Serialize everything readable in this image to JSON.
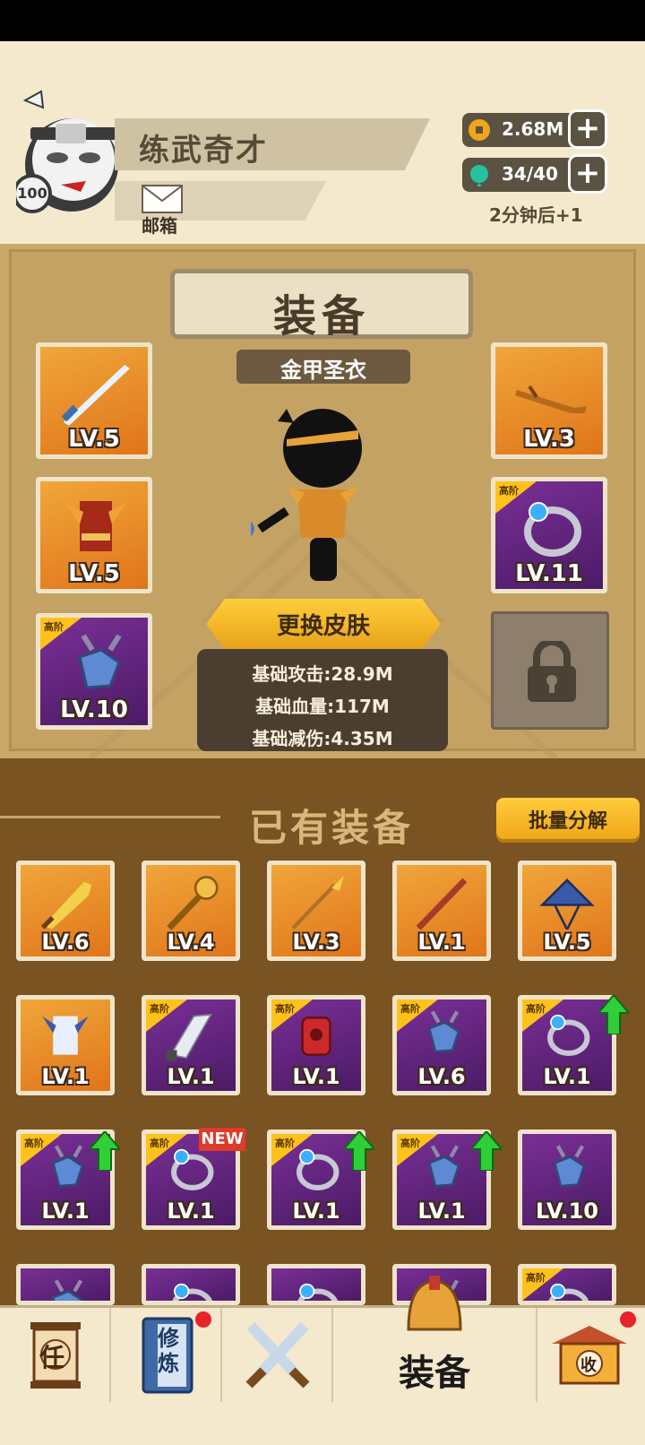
{
  "player": {
    "name": "练武奇才",
    "level": "100",
    "mail_label": "邮箱"
  },
  "resources": {
    "coins": "2.68M",
    "energy": "34/40",
    "timer": "2分钟后+1"
  },
  "equip_panel": {
    "title": "装备",
    "set_name": "金甲圣衣",
    "skin_button": "更换皮肤",
    "stats": [
      "基础攻击:28.9M",
      "基础血量:117M",
      "基础减伤:4.35M"
    ],
    "slots": [
      {
        "item": "sword",
        "level": "LV.5",
        "rarity": "orange",
        "tier": ""
      },
      {
        "item": "armor",
        "level": "LV.5",
        "rarity": "orange",
        "tier": ""
      },
      {
        "item": "amulet",
        "level": "LV.10",
        "rarity": "purple",
        "tier": "高阶"
      },
      {
        "item": "blade-hilt",
        "level": "LV.3",
        "rarity": "orange",
        "tier": ""
      },
      {
        "item": "ring",
        "level": "LV.11",
        "rarity": "purple",
        "tier": "高阶"
      }
    ]
  },
  "owned": {
    "title": "已有装备",
    "batch_button": "批量分解",
    "new_label": "NEW",
    "items": [
      {
        "item": "broadsword",
        "level": "LV.6",
        "rarity": "orange",
        "tier": ""
      },
      {
        "item": "mace",
        "level": "LV.4",
        "rarity": "orange",
        "tier": ""
      },
      {
        "item": "spear",
        "level": "LV.3",
        "rarity": "orange",
        "tier": ""
      },
      {
        "item": "staff",
        "level": "LV.1",
        "rarity": "orange",
        "tier": ""
      },
      {
        "item": "hat",
        "level": "LV.5",
        "rarity": "orange",
        "tier": ""
      },
      {
        "item": "robe",
        "level": "LV.1",
        "rarity": "orange",
        "tier": ""
      },
      {
        "item": "machete",
        "level": "LV.1",
        "rarity": "purple",
        "tier": "高阶"
      },
      {
        "item": "gauntlet",
        "level": "LV.1",
        "rarity": "purple",
        "tier": "高阶"
      },
      {
        "item": "amulet",
        "level": "LV.6",
        "rarity": "purple",
        "tier": "高阶"
      },
      {
        "item": "ring",
        "level": "LV.1",
        "rarity": "purple",
        "tier": "高阶"
      },
      {
        "item": "amulet",
        "level": "LV.1",
        "rarity": "purple",
        "tier": "高阶"
      },
      {
        "item": "ring",
        "level": "LV.1",
        "rarity": "purple",
        "tier": "高阶"
      },
      {
        "item": "ring",
        "level": "LV.1",
        "rarity": "purple",
        "tier": "高阶"
      },
      {
        "item": "amulet",
        "level": "LV.1",
        "rarity": "purple",
        "tier": "高阶"
      },
      {
        "item": "amulet",
        "level": "LV.10",
        "rarity": "purple",
        "tier": ""
      },
      {
        "item": "amulet",
        "level": "",
        "rarity": "purple",
        "tier": ""
      },
      {
        "item": "ring",
        "level": "",
        "rarity": "purple",
        "tier": ""
      },
      {
        "item": "ring",
        "level": "",
        "rarity": "purple",
        "tier": ""
      },
      {
        "item": "amulet",
        "level": "",
        "rarity": "purple",
        "tier": ""
      },
      {
        "item": "ring",
        "level": "",
        "rarity": "purple",
        "tier": "高阶"
      }
    ]
  },
  "nav": {
    "task": "任",
    "cultivate": "修炼",
    "equip": "装备",
    "collect": "收"
  },
  "colors": {
    "orange": "#e0751a",
    "purple": "#5b2277",
    "tier": "#ffc21a",
    "upgrade": "#2fcf3a"
  }
}
